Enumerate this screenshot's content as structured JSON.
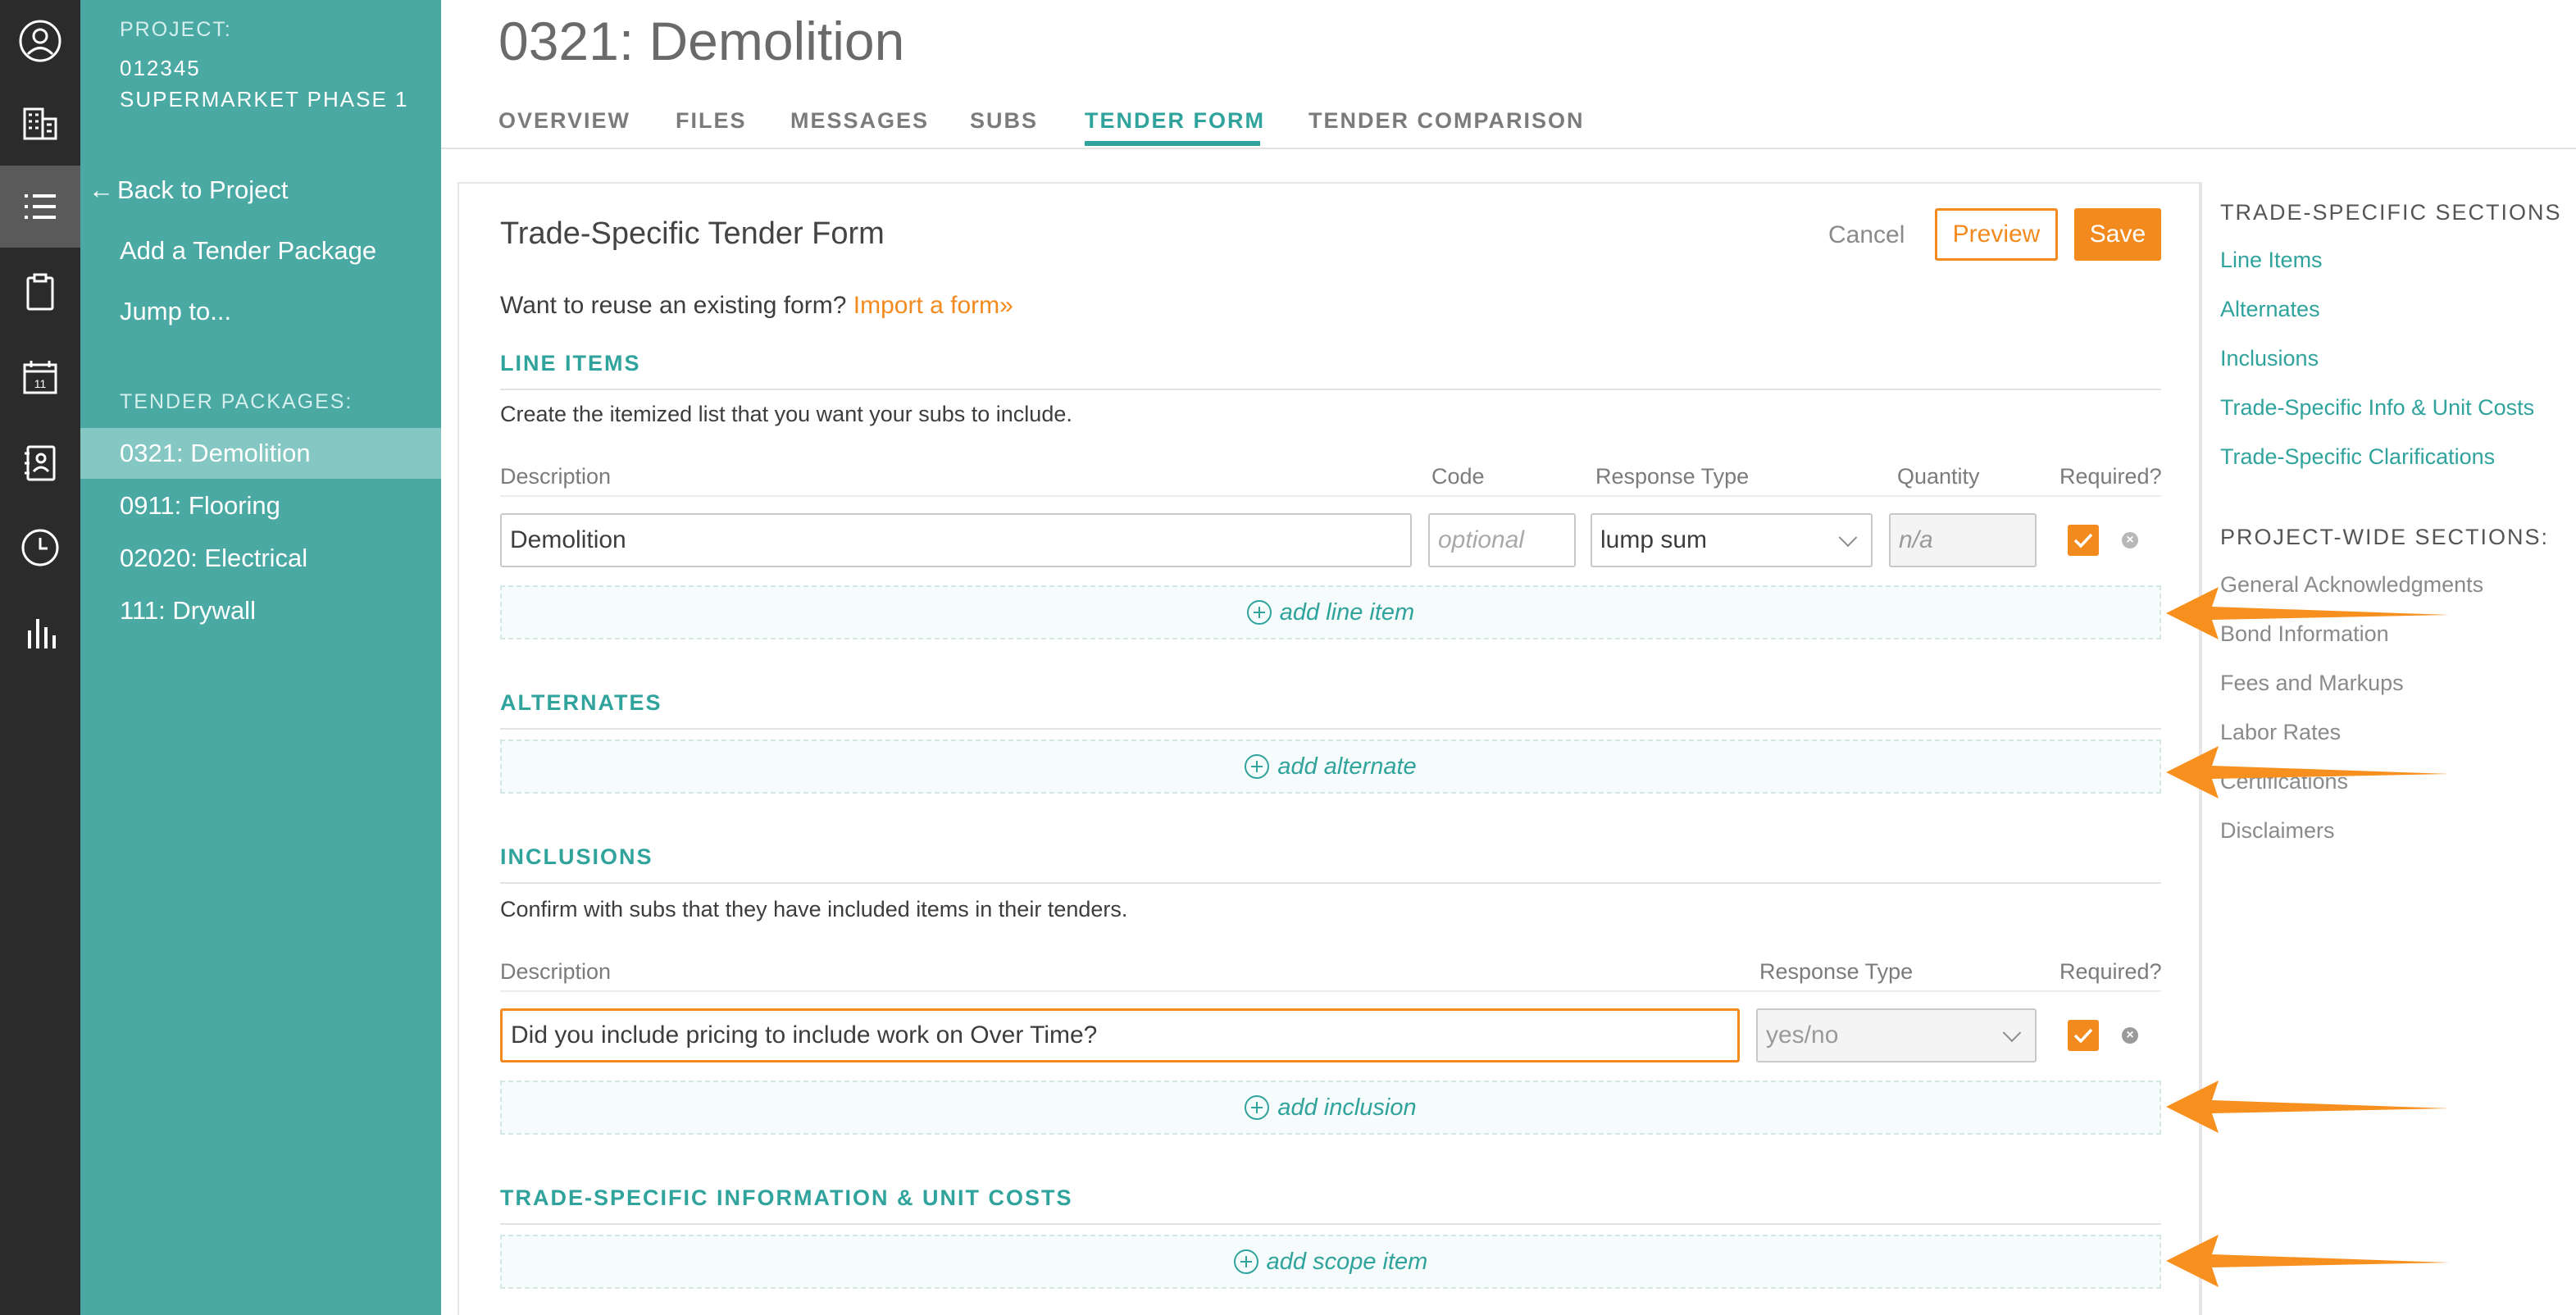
{
  "rail": {
    "icons": [
      "user-icon",
      "building-icon",
      "list-icon",
      "clipboard-icon",
      "calendar-icon",
      "contacts-icon",
      "clock-icon",
      "bar-chart-icon"
    ],
    "calendar_day": "11"
  },
  "sidebar": {
    "project_label": "PROJECT:",
    "project_number": "012345",
    "project_name": "SUPERMARKET PHASE 1",
    "back_link": "Back to Project",
    "add_package": "Add a Tender Package",
    "jump_to": "Jump to...",
    "packages_label": "TENDER PACKAGES:",
    "packages": [
      {
        "label": "0321: Demolition",
        "active": true
      },
      {
        "label": "0911: Flooring"
      },
      {
        "label": "02020: Electrical"
      },
      {
        "label": "111: Drywall"
      }
    ]
  },
  "header": {
    "title": "0321: Demolition",
    "tabs": [
      {
        "label": "OVERVIEW"
      },
      {
        "label": "FILES"
      },
      {
        "label": "MESSAGES"
      },
      {
        "label": "SUBS"
      },
      {
        "label": "TENDER FORM",
        "active": true
      },
      {
        "label": "TENDER COMPARISON"
      }
    ]
  },
  "form": {
    "title": "Trade-Specific Tender Form",
    "cancel": "Cancel",
    "preview": "Preview",
    "save": "Save",
    "reuse_text": "Want to reuse an existing form?",
    "import_link": "Import a form»",
    "line_items": {
      "heading": "LINE ITEMS",
      "description": "Create the itemized list that you want your subs to include.",
      "columns": [
        "Description",
        "Code",
        "Response Type",
        "Quantity",
        "Required?"
      ],
      "row": {
        "description": "Demolition",
        "code_placeholder": "optional",
        "response_type": "lump sum",
        "quantity_placeholder": "n/a",
        "required": true
      },
      "add_label": "add line item"
    },
    "alternates": {
      "heading": "ALTERNATES",
      "add_label": "add alternate"
    },
    "inclusions": {
      "heading": "INCLUSIONS",
      "description": "Confirm with subs that they have included items in their tenders.",
      "columns": [
        "Description",
        "Response Type",
        "Required?"
      ],
      "row": {
        "description": "Did you include pricing to include work on Over Time?",
        "response_type": "yes/no",
        "required": true
      },
      "add_label": "add inclusion"
    },
    "trade_info": {
      "heading": "TRADE-SPECIFIC INFORMATION & UNIT COSTS",
      "add_label": "add scope item"
    }
  },
  "right_nav": {
    "trade_heading": "TRADE-SPECIFIC SECTIONS",
    "trade_links": [
      "Line Items",
      "Alternates",
      "Inclusions",
      "Trade-Specific Info & Unit Costs",
      "Trade-Specific Clarifications"
    ],
    "project_heading": "PROJECT-WIDE SECTIONS:",
    "project_links": [
      "General Acknowledgments",
      "Bond Information",
      "Fees and Markups",
      "Labor Rates",
      "Certifications",
      "Disclaimers"
    ]
  },
  "colors": {
    "teal": "#4ba9a4",
    "accent_teal": "#2fa39c",
    "orange": "#f28a1e",
    "dark": "#2b2b2b"
  }
}
